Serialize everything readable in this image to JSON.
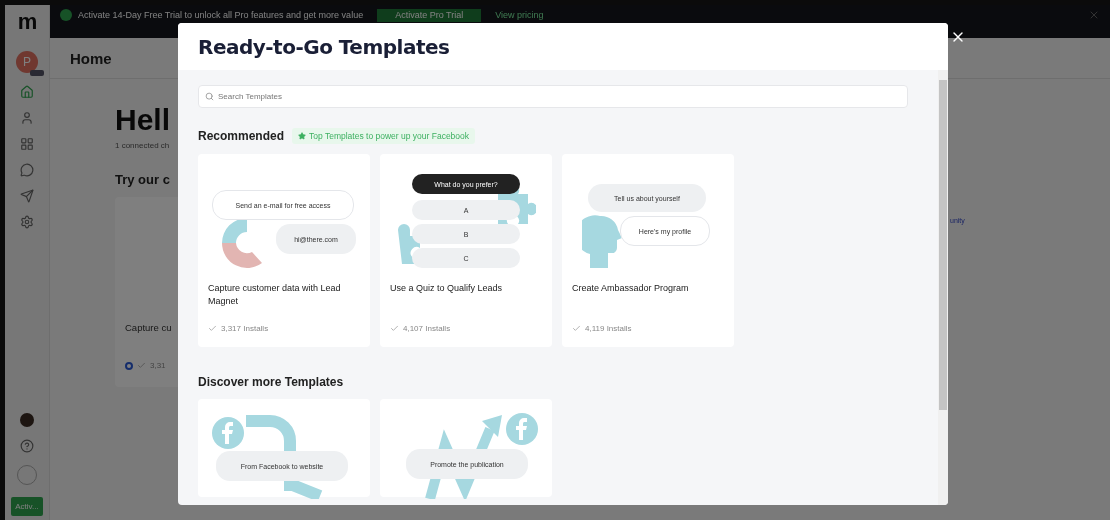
{
  "banner": {
    "text": "Activate 14-Day Free Trial to unlock all Pro features and get more value",
    "button": "Activate Pro Trial",
    "link": "View pricing"
  },
  "sidebar": {
    "logo": "m",
    "avatar_letter": "P",
    "items": [
      {
        "selected": true
      },
      {
        "selected": false
      },
      {
        "selected": false
      },
      {
        "selected": false
      },
      {
        "selected": false
      },
      {
        "selected": false
      }
    ],
    "bottom_button": "Activ..."
  },
  "page": {
    "title": "Home",
    "heading": "Hell",
    "subtitle": "1 connected ch",
    "section": "Try our c",
    "card_title": "Capture cu",
    "card_installs": "3,31",
    "side_link": "unity"
  },
  "modal": {
    "title": "Ready-to-Go Templates",
    "search": {
      "placeholder": "Search Templates"
    },
    "sections": [
      {
        "title": "Recommended",
        "badge": "Top Templates to power up your Facebook",
        "cards": [
          {
            "kind": "magnet",
            "labels": [
              "Send an e-mail for free access",
              "hi@there.com"
            ],
            "title": "Capture customer data with Lead Magnet",
            "installs": "3,317 Installs"
          },
          {
            "kind": "quiz",
            "labels": [
              "What do you prefer?",
              "A",
              "B",
              "C"
            ],
            "title": "Use a Quiz to Qualify Leads",
            "installs": "4,107 Installs"
          },
          {
            "kind": "profile",
            "labels": [
              "Tell us about yourself",
              "Here's my profile"
            ],
            "title": "Create Ambassador Program",
            "installs": "4,119 Installs"
          }
        ]
      },
      {
        "title": "Discover more Templates",
        "cards": [
          {
            "kind": "website",
            "labels": [
              "From Facebook to website"
            ]
          },
          {
            "kind": "promote",
            "labels": [
              "Promote the publication"
            ]
          }
        ]
      }
    ]
  }
}
